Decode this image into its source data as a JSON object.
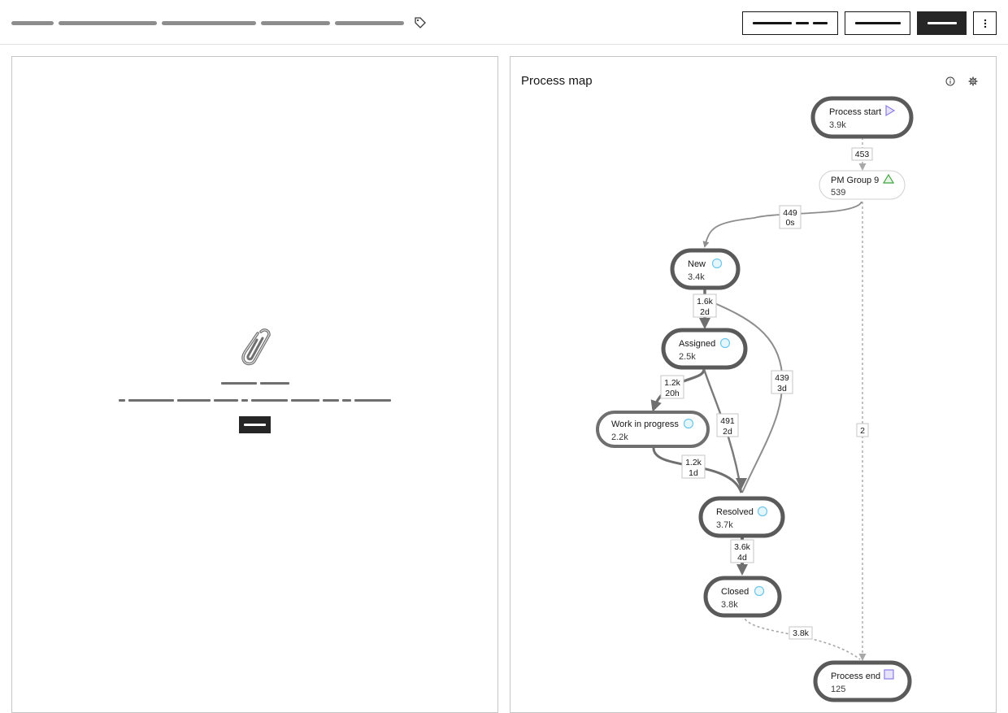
{
  "panel": {
    "title": "Process map"
  },
  "nodes": [
    {
      "id": "start",
      "label": "Process start",
      "count": "3.9k",
      "icon": "play-triangle",
      "color": "#8a7fe6"
    },
    {
      "id": "pm",
      "label": "PM Group 9",
      "count": "539",
      "icon": "warning-triangle",
      "color": "#3fa33f"
    },
    {
      "id": "new",
      "label": "New",
      "count": "3.4k",
      "icon": "circle",
      "color": "#6ec6e8"
    },
    {
      "id": "assigned",
      "label": "Assigned",
      "count": "2.5k",
      "icon": "circle",
      "color": "#6ec6e8"
    },
    {
      "id": "wip",
      "label": "Work in progress",
      "count": "2.2k",
      "icon": "circle",
      "color": "#6ec6e8"
    },
    {
      "id": "resolved",
      "label": "Resolved",
      "count": "3.7k",
      "icon": "circle",
      "color": "#6ec6e8"
    },
    {
      "id": "closed",
      "label": "Closed",
      "count": "3.8k",
      "icon": "circle",
      "color": "#6ec6e8"
    },
    {
      "id": "end",
      "label": "Process end",
      "count": "125",
      "icon": "square",
      "color": "#8a7fe6"
    }
  ],
  "edges": [
    {
      "id": "start-pm",
      "l1": "453",
      "l2": ""
    },
    {
      "id": "pm-new",
      "l1": "449",
      "l2": "0s"
    },
    {
      "id": "new-assigned",
      "l1": "1.6k",
      "l2": "2d"
    },
    {
      "id": "new-resolved",
      "l1": "439",
      "l2": "3d"
    },
    {
      "id": "assigned-wip",
      "l1": "1.2k",
      "l2": "20h"
    },
    {
      "id": "assigned-resolved",
      "l1": "491",
      "l2": "2d"
    },
    {
      "id": "wip-resolved",
      "l1": "1.2k",
      "l2": "1d"
    },
    {
      "id": "resolved-closed",
      "l1": "3.6k",
      "l2": "4d"
    },
    {
      "id": "closed-end",
      "l1": "3.8k",
      "l2": ""
    },
    {
      "id": "pm-end",
      "l1": "2",
      "l2": ""
    }
  ],
  "colors": {
    "node_border": "#5a5a5a",
    "edge": "#8d8d8d",
    "primary_button": "#262626"
  }
}
